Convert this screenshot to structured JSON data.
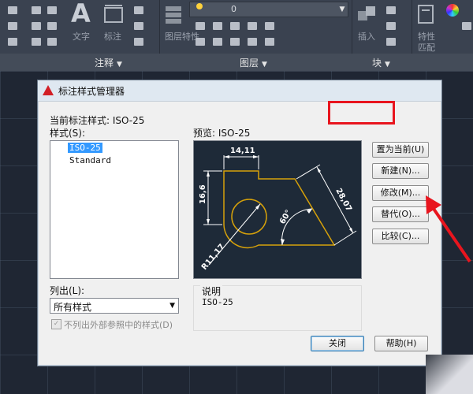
{
  "ribbon": {
    "panels": {
      "annotation": "注释",
      "layers": "图层",
      "block": "块"
    },
    "tools": {
      "text": "文字",
      "dimension": "标注",
      "layer_props": "图层特性",
      "insert": "插入",
      "properties": "特性",
      "match": "匹配",
      "layer_name": "0"
    }
  },
  "dialog": {
    "title": "标注样式管理器",
    "current_style_label": "当前标注样式: ISO-25",
    "styles_label": "样式(S):",
    "styles": [
      "ISO-25",
      "Standard"
    ],
    "selected_style": "ISO-25",
    "list_label": "列出(L):",
    "list_value": "所有样式",
    "exclude_xref_label": "不列出外部参照中的样式(D)",
    "preview_label": "预览: ISO-25",
    "description_label": "说明",
    "description_value": "ISO-25",
    "buttons": {
      "set_current": "置为当前(U)",
      "new": "新建(N)...",
      "modify": "修改(M)...",
      "override": "替代(O)...",
      "compare": "比较(C)...",
      "close": "关闭",
      "help": "帮助(H)"
    },
    "preview_dims": {
      "top": "14,11",
      "left": "16,6",
      "right": "28,07",
      "angle": "60°",
      "radius": "R11,17"
    }
  },
  "colors": {
    "accent_red": "#e8151e",
    "dim_line": "#ffffff",
    "geometry": "#d6a10a",
    "selection": "#3399ff"
  }
}
